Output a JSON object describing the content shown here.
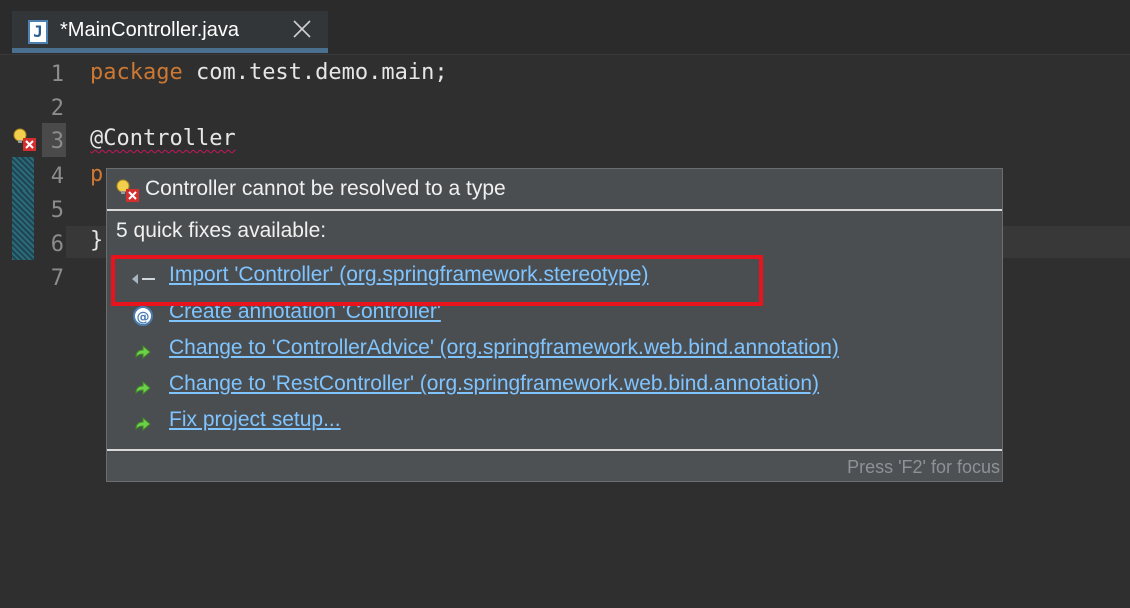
{
  "tab": {
    "title": "*MainController.java",
    "icon_letter": "J"
  },
  "editor": {
    "lines": [
      {
        "num": "1",
        "parts": [
          {
            "text": "package",
            "kind": "kw"
          },
          {
            "text": " com.test.demo.main;",
            "kind": "plain"
          }
        ]
      },
      {
        "num": "2",
        "parts": []
      },
      {
        "num": "3",
        "parts": [
          {
            "text": "@Controller",
            "kind": "error"
          }
        ]
      },
      {
        "num": "4",
        "parts": [
          {
            "text": "p",
            "kind": "kw"
          }
        ]
      },
      {
        "num": "5",
        "parts": []
      },
      {
        "num": "6",
        "parts": [
          {
            "text": "}",
            "kind": "plain"
          }
        ]
      },
      {
        "num": "7",
        "parts": []
      }
    ]
  },
  "popup": {
    "header": "Controller cannot be resolved to a type",
    "count": "5 quick fixes available:",
    "fixes": [
      {
        "label": "Import 'Controller' (org.springframework.stereotype)",
        "icon": "import-icon"
      },
      {
        "label": "Create annotation 'Controller'",
        "icon": "annotation-icon"
      },
      {
        "label": "Change to 'ControllerAdvice' (org.springframework.web.bind.annotation)",
        "icon": "change-arrow-icon"
      },
      {
        "label": "Change to 'RestController' (org.springframework.web.bind.annotation)",
        "icon": "change-arrow-icon"
      },
      {
        "label": "Fix project setup...",
        "icon": "change-arrow-icon"
      }
    ],
    "footer": "Press 'F2' for focus"
  },
  "colors": {
    "keyword": "#cc7832",
    "link": "#7fc4ff",
    "highlight_border": "#e8131c",
    "error_underline": "#c2185b"
  }
}
